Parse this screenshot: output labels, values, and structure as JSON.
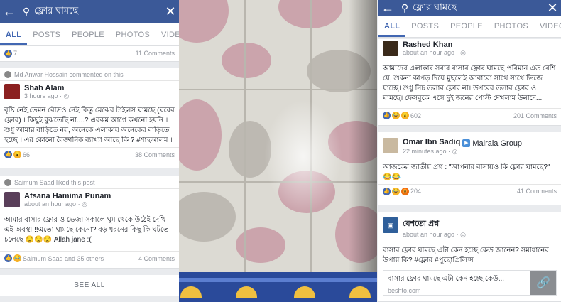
{
  "search": {
    "query": "ফ্লোর ঘামছে"
  },
  "tabs": [
    "ALL",
    "POSTS",
    "PEOPLE",
    "PHOTOS",
    "VIDEOS"
  ],
  "left": {
    "top_reaction": {
      "count": "7",
      "comments": "11 Comments"
    },
    "post1": {
      "activity": "Md Anwar Hossain commented on this",
      "author": "Shah Alam",
      "time": "3 hours ago",
      "text": "বৃষ্টি নেই,তেমন রৌদ্রও নেই কিন্তু মেঝের টাইলস ঘামছে (ঘরের ফ্লোর) । কিছুই বুঝতেছি না....? এরকম আগে কখনো হয়নি । শুধু আমার বাড়িতে নয়, অনেকে এলাকায় অনেকের বাড়িতে হচ্ছে । এর কোনো বৈজ্ঞানিক ব্যাখ্যা আছে কি ? #শাহআলম ।",
      "reactions": "66",
      "comments": "38 Comments"
    },
    "post2": {
      "activity": "Saimum Saad liked this post",
      "author": "Afsana Hamima Punam",
      "time": "about an hour ago",
      "text": "আমার বাসার ফ্লোর ও ভেজা সকালে ঘুম থেকে উঠেই দেখি এই অবস্থা !!এতো ঘামছে কেনো? বড় ধরনের কিছু কি ঘটতে চলেছে 😒😒😒 Allah jane :(",
      "reactions": "Saimum Saad and 35 others",
      "comments": "4 Comments"
    },
    "see_all": "SEE ALL"
  },
  "right": {
    "post1": {
      "author": "Rashed Khan",
      "time": "about an hour ago",
      "text": "আমাদের এলাকার সবার বাসার ফ্লোর ঘামছে।পরিমান এত বেশি যে, শুকনা কাপড় দিয়ে মুছলেই আবারো সাথে সাথে ভিজে যাচ্ছে। শুধু নিচ তলার ফ্লোর না। উপরের তলার ফ্লোর ও ঘামছে। ফেসবুকে এসে দুই জনের পোস্ট দেখলাম উনাদে...",
      "reactions": "602",
      "comments": "201 Comments"
    },
    "post2": {
      "author": "Omar Ibn Sadiq",
      "group": "Mairala Group",
      "time": "22 minutes ago",
      "text": "আজকের জাতীয় প্রশ্ন : \"আপনার বাসায়ও কি ফ্লোর ঘামছে?\" 😂😂",
      "reactions": "204",
      "comments": "41 Comments"
    },
    "post3": {
      "author": "বেশতো প্রশ্ন",
      "time": "about an hour ago",
      "text": "বাসার ফ্লোর ঘামছে এটা কেন হচ্ছে কেউ জানেন? সমাধানের উপায় কি? #ফ্লোর #পুছোপ্রিলিপ্স",
      "link_title": "বাসার ফ্লোর ঘামছে এটা কেন হচ্ছে কেউ...",
      "link_domain": "beshto.com"
    }
  },
  "colors": {
    "facebook_blue": "#3b5998",
    "tab_active": "#4267b2",
    "tile_pink": "#c89aa4",
    "border_blue": "#2a4a9a"
  }
}
